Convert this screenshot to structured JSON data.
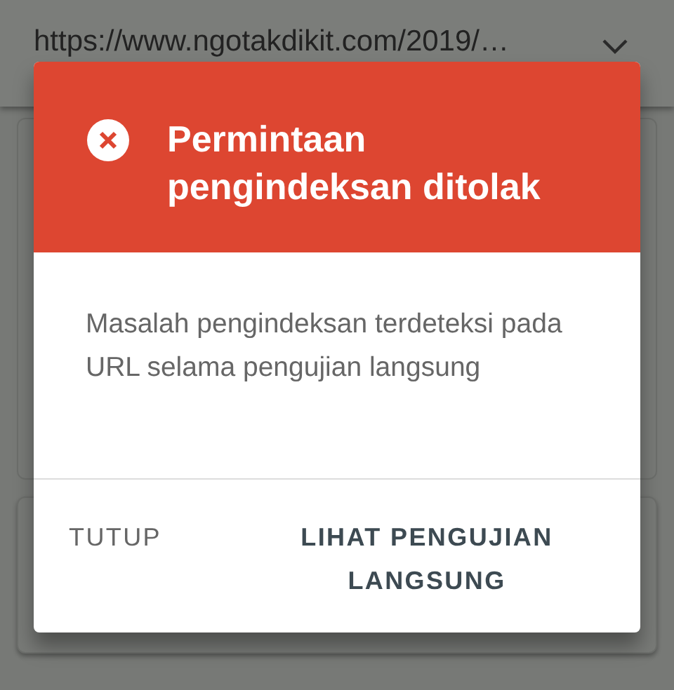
{
  "url_bar": {
    "url": "https://www.ngotakdikit.com/2019/…"
  },
  "dialog": {
    "title": "Permintaan pengindeksan ditolak",
    "message": "Masalah pengindeksan terdeteksi pada URL selama pengujian langsung",
    "buttons": [
      {
        "label": "TUTUP",
        "kind": "secondary"
      },
      {
        "label": "LIHAT PENGUJIAN LANGSUNG",
        "kind": "primary"
      }
    ]
  }
}
